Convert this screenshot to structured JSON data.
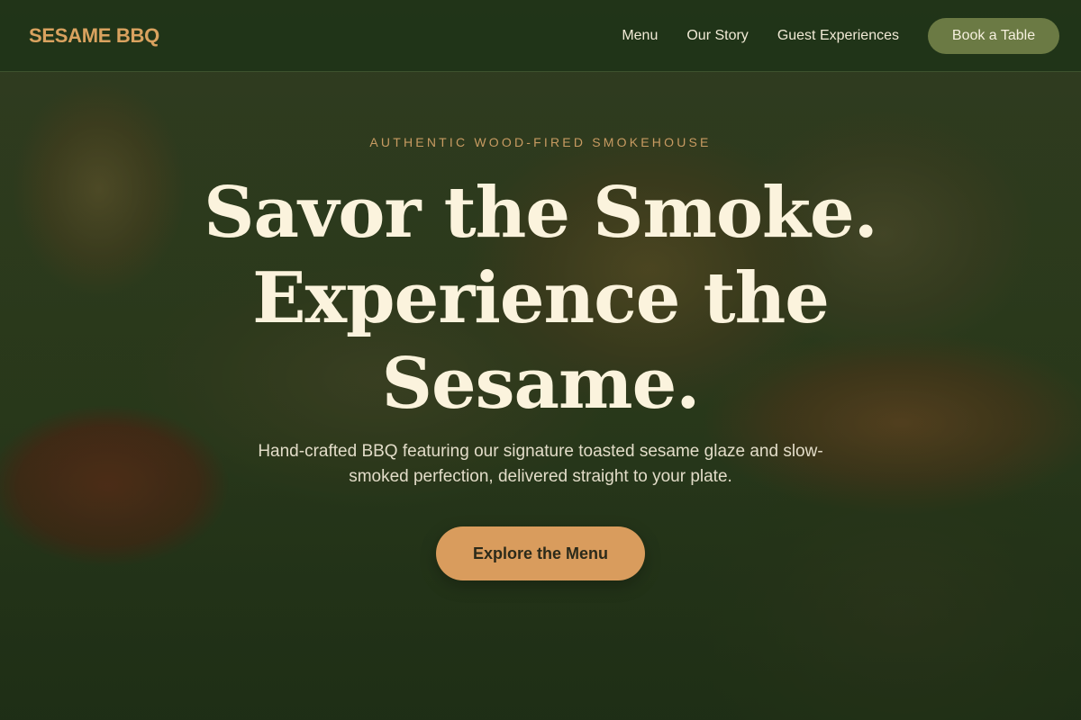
{
  "brand": {
    "name": "SESAME BBQ",
    "accent_color": "#d9a25f"
  },
  "nav": {
    "links": [
      {
        "label": "Menu"
      },
      {
        "label": "Our Story"
      },
      {
        "label": "Guest Experiences"
      }
    ],
    "cta_label": "Book a Table"
  },
  "hero": {
    "eyebrow": "AUTHENTIC WOOD-FIRED SMOKEHOUSE",
    "headline": "Savor the Smoke. Experience the Sesame.",
    "subtext": "Hand-crafted BBQ featuring our signature toasted sesame glaze and slow-smoked perfection, delivered straight to your plate.",
    "cta_label": "Explore the Menu",
    "background_image": "bbq-platter-photo"
  },
  "colors": {
    "nav_background": "#203418",
    "book_button": "#6b7a44",
    "cta_button": "#d99c5d",
    "headline_text": "#fbf3dd"
  }
}
